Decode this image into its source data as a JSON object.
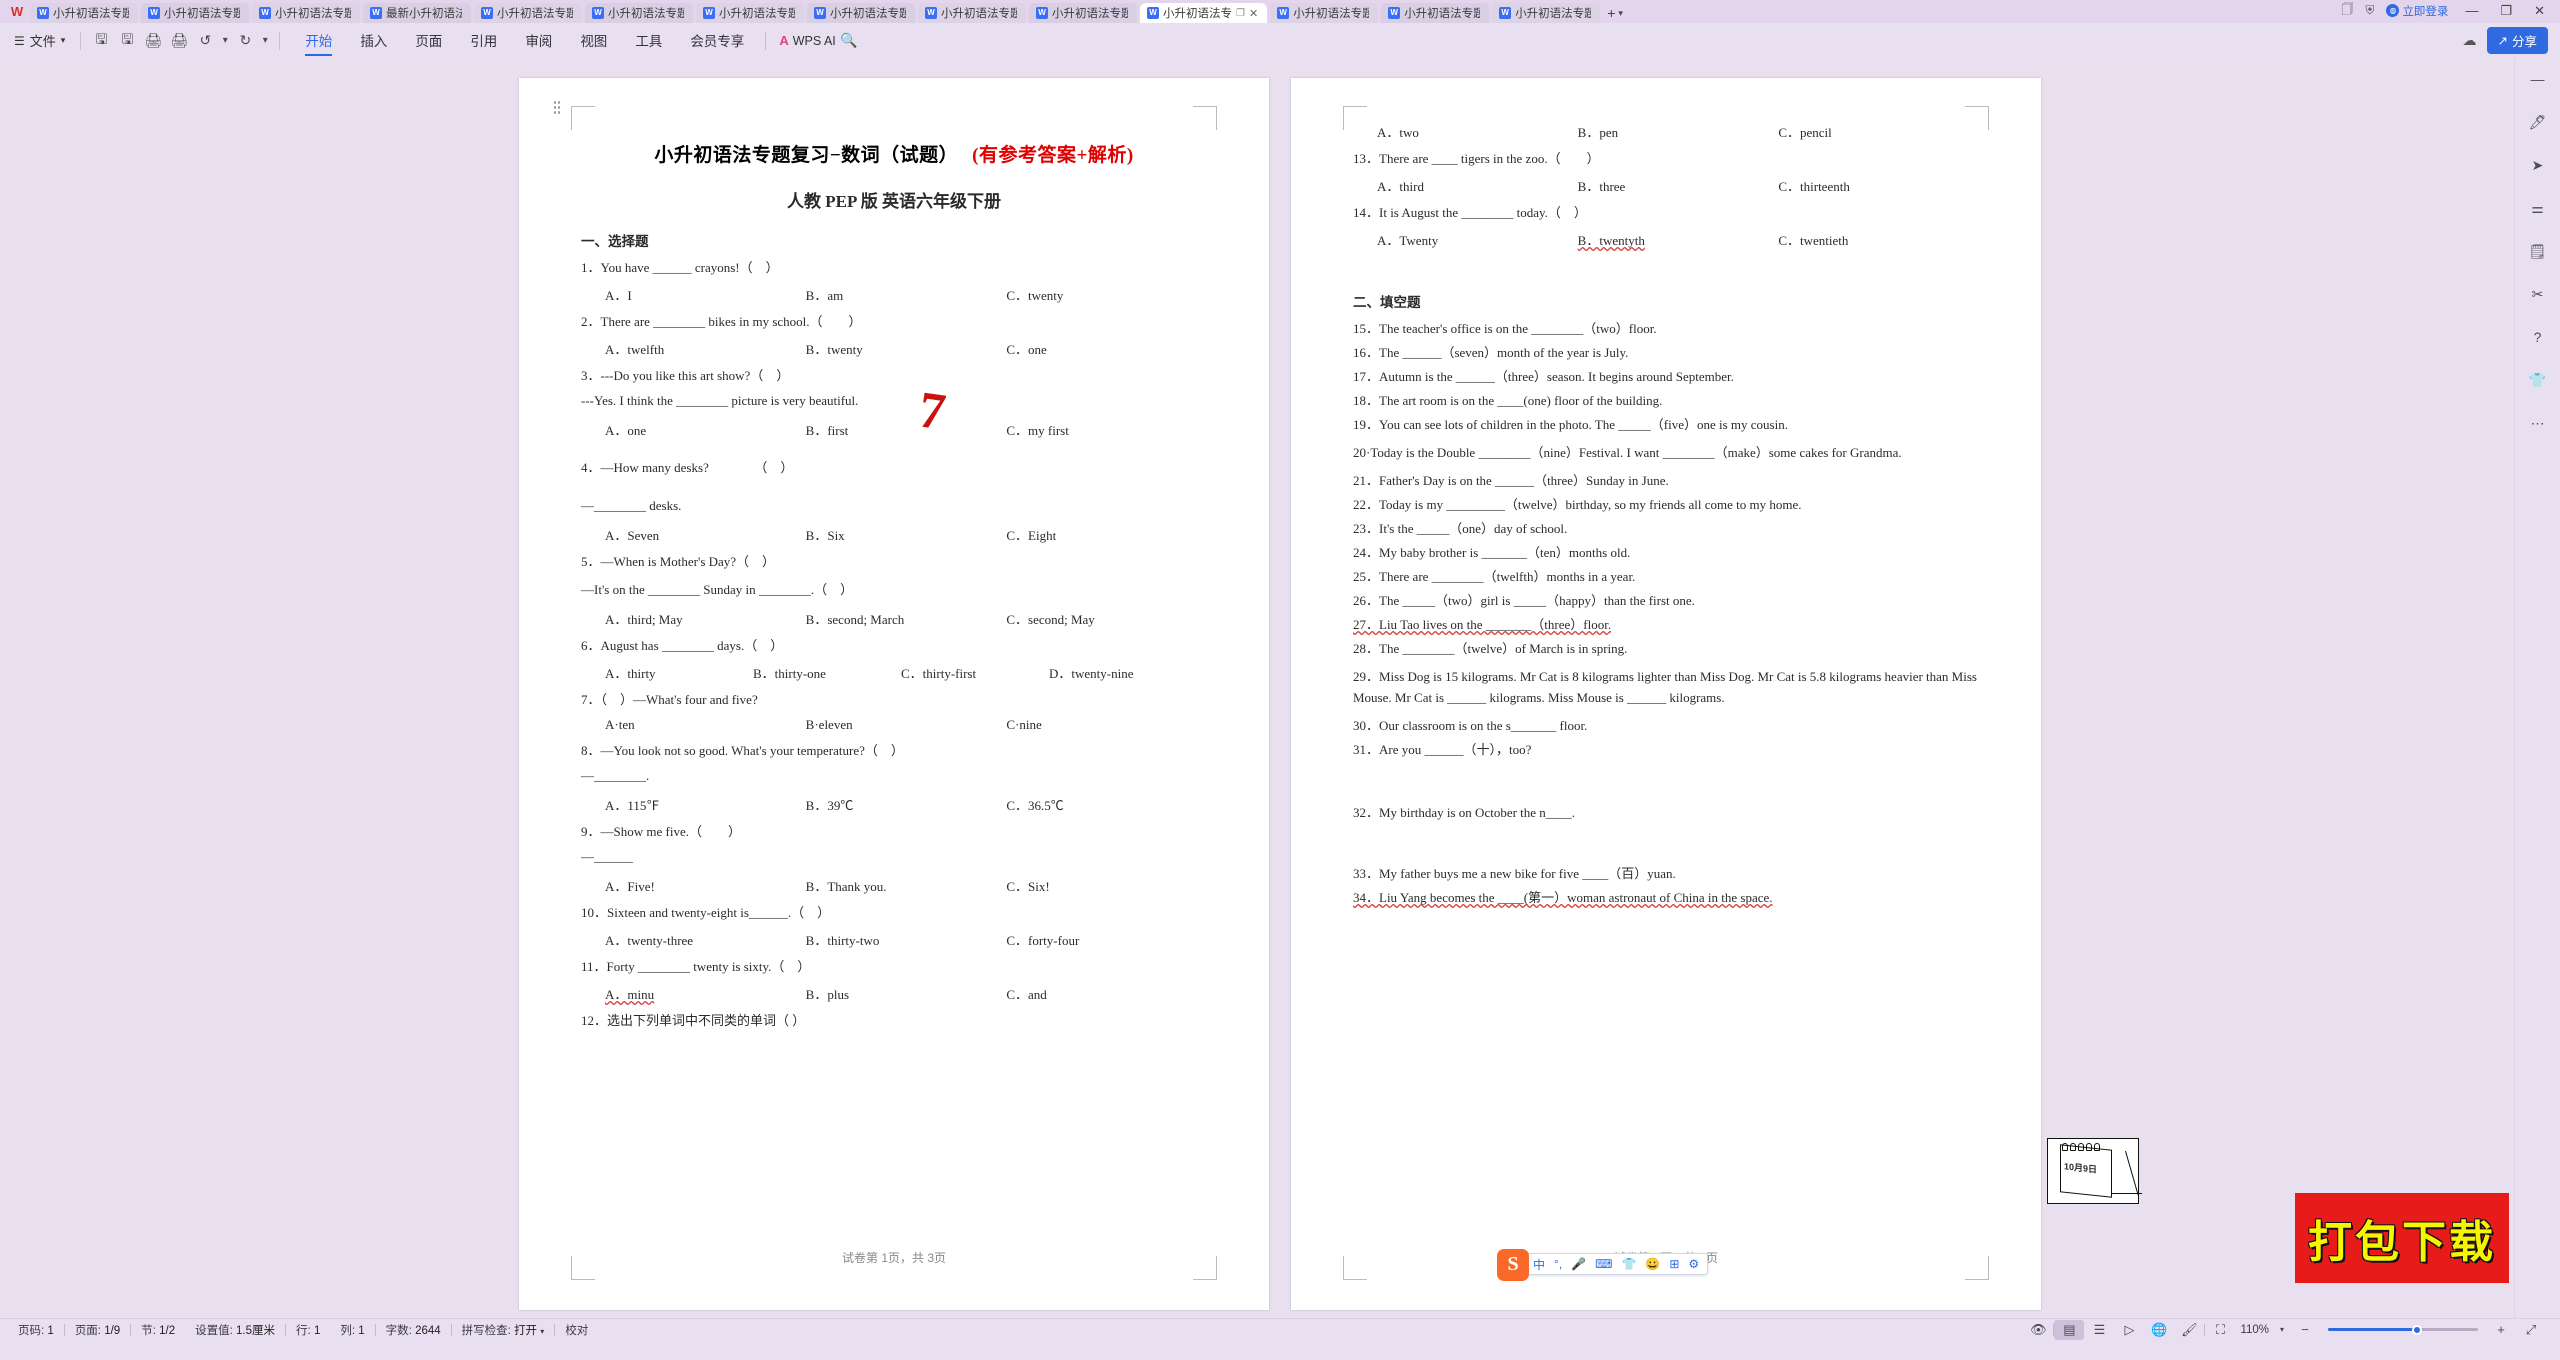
{
  "window": {
    "tabs": [
      {
        "label": "小升初语法专题复习",
        "active": false
      },
      {
        "label": "小升初语法专题复习",
        "active": false
      },
      {
        "label": "小升初语法专题复习",
        "active": false
      },
      {
        "label": "最新小升初语法专题",
        "active": false
      },
      {
        "label": "小升初语法专题复习",
        "active": false
      },
      {
        "label": "小升初语法专题复习",
        "active": false
      },
      {
        "label": "小升初语法专题复习",
        "active": false
      },
      {
        "label": "小升初语法专题复习",
        "active": false
      },
      {
        "label": "小升初语法专题复习",
        "active": false
      },
      {
        "label": "小升初语法专题复习",
        "active": false
      },
      {
        "label": "小升初语法专",
        "active": true
      },
      {
        "label": "小升初语法专题复习",
        "active": false
      },
      {
        "label": "小升初语法专题复习",
        "active": false
      },
      {
        "label": "小升初语法专题复习",
        "active": false
      }
    ],
    "new_tab_label": "+",
    "login_label": "立即登录",
    "minimize": "—",
    "restore": "❐",
    "close": "✕"
  },
  "ribbon": {
    "file_label": "文件",
    "quick_icons": [
      "save-icon",
      "save-as-icon",
      "print-icon",
      "print-preview-icon",
      "undo-icon",
      "redo-icon"
    ],
    "menus": [
      {
        "label": "开始",
        "active": true
      },
      {
        "label": "插入",
        "active": false
      },
      {
        "label": "页面",
        "active": false
      },
      {
        "label": "引用",
        "active": false
      },
      {
        "label": "审阅",
        "active": false
      },
      {
        "label": "视图",
        "active": false
      },
      {
        "label": "工具",
        "active": false
      },
      {
        "label": "会员专享",
        "active": false
      }
    ],
    "wps_ai": "WPS AI",
    "search": "search-icon",
    "share_label": "分享"
  },
  "document": {
    "title": "小升初语法专题复习−数词（试题）",
    "title_red": "(有参考答案+解析)",
    "subtitle": "人教 PEP 版 英语六年级下册",
    "section1": "一、选择题",
    "section2": "二、填空题",
    "pen_mark": "7",
    "calendar_text": "10月9日",
    "page1_footer": "试卷第 1页，共 3页",
    "page2_footer": "试卷第 2页，共 3页",
    "q1": "1．You have ______ crayons!（　）",
    "q1opts": [
      "A．I",
      "B．am",
      "C．twenty"
    ],
    "q2": "2．There are ________ bikes in my school.（　　）",
    "q2opts": [
      "A．twelfth",
      "B．twenty",
      "C．one"
    ],
    "q3": "3．---Do you like this art show?（　）",
    "q3b": "---Yes. I think the ________ picture is very beautiful.",
    "q3opts": [
      "A．one",
      "B．first",
      "C．my first"
    ],
    "q4": "4．—How many desks?　　　　（　）",
    "q4b": "—________ desks.",
    "q4opts": [
      "A．Seven",
      "B．Six",
      "C．Eight"
    ],
    "q5": "5．—When is Mother's Day?（　）",
    "q5b": "—It's on the ________ Sunday in ________.（　）",
    "q5opts": [
      "A．third; May",
      "B．second; March",
      "C．second; May"
    ],
    "q6": "6．August has ________ days.（　）",
    "q6opts": [
      "A．thirty",
      "B．thirty-one",
      "C．thirty-first",
      "D．twenty-nine"
    ],
    "q7": "7．（　）—What's four and five?",
    "q7opts": [
      "A·ten",
      "B·eleven",
      "C·nine"
    ],
    "q8": "8．—You look not so good. What's your temperature?（　）",
    "q8b": "—________.",
    "q8opts": [
      "A．115℉",
      "B．39℃",
      "C．36.5℃"
    ],
    "q9": "9．—Show me five.（　　）",
    "q9b": "—______",
    "q9opts": [
      "A．Five!",
      "B．Thank you.",
      "C．Six!"
    ],
    "q10": "10．Sixteen and twenty-eight is______.（　）",
    "q10opts": [
      "A．twenty-three",
      "B．thirty-two",
      "C．forty-four"
    ],
    "q11": "11．Forty ________ twenty is sixty.（　）",
    "q11opts": [
      "A．minu",
      "B．plus",
      "C．and"
    ],
    "q12": "12．选出下列单词中不同类的单词（ ）",
    "q12opts": [
      "A．two",
      "B．pen",
      "C．pencil"
    ],
    "q13": "13．There are ____ tigers in the zoo.（　　）",
    "q13opts": [
      "A．third",
      "B．three",
      "C．thirteenth"
    ],
    "q14": "14．It is August the ________ today.（　）",
    "q14opts": [
      "A．Twenty",
      "B．twentyth",
      "C．twentieth"
    ],
    "q15": "15．The teacher's office is on the ________（two）floor.",
    "q16": "16．The ______（seven）month of the year is July.",
    "q17": "17．Autumn is the ______（three）season. It begins around September.",
    "q18": "18．The art room is on the ____(one) floor of the building.",
    "q19": "19．You can see lots of children in the photo. The _____（five）one is my cousin.",
    "q20": "20·Today is the Double ________（nine）Festival. I want ________（make）some cakes for Grandma.",
    "q21": "21．Father's Day is on the ______（three）Sunday in June.",
    "q22": "22．Today is my _________（twelve）birthday, so my friends all come to my home.",
    "q23": "23．It's the _____（one）day of school.",
    "q24": "24．My baby brother is _______（ten）months old.",
    "q25": "25．There are ________（twelfth）months in a year.",
    "q26": "26．The _____（two）girl is _____（happy）than the first one.",
    "q27": "27．Liu Tao lives on the _______（three）floor.",
    "q28": "28．The ________（twelve）of March is in spring.",
    "q29": "29．Miss Dog is 15 kilograms. Mr Cat is 8 kilograms lighter than Miss Dog. Mr Cat is 5.8 kilograms heavier than Miss Mouse. Mr Cat is ______ kilograms. Miss Mouse is ______ kilograms.",
    "q30": "30．Our classroom is on the s_______ floor.",
    "q31": "31．Are you ______（十），too?",
    "q32": "32．My birthday is on October the n____.",
    "q33": "33．My father buys me a new bike for five ____（百）yuan.",
    "q34": "34．Liu Yang becomes the ____(第一）woman astronaut of China in the space."
  },
  "ime": {
    "logo": "S",
    "items": [
      "中",
      "°,",
      "mic-icon",
      "keyboard-icon",
      "skin-icon",
      "emoji-icon",
      "apps-icon",
      "settings-icon"
    ]
  },
  "watermark": {
    "text": "打包下载"
  },
  "right_toolbar": {
    "icons": [
      "collapse-icon",
      "pen-icon",
      "cursor-icon",
      "slider-icon",
      "scan-icon",
      "tools-icon",
      "help-icon",
      "skin-icon",
      "more-icon"
    ]
  },
  "status_bar": {
    "page_no_label": "页码:",
    "page_no": "1",
    "pages_label": "页面:",
    "pages": "1/9",
    "section_label": "节:",
    "section": "1/2",
    "setting_label": "设置值:",
    "setting": "1.5厘米",
    "row_label": "行:",
    "row": "1",
    "col_label": "列:",
    "col": "1",
    "words_label": "字数:",
    "words": "2644",
    "spell_label": "拼写检查:",
    "spell": "打开",
    "proof_label": "校对",
    "zoom": "110%",
    "view_icons": [
      "eye-icon",
      "page-view-icon",
      "outline-view-icon",
      "play-icon",
      "web-view-icon",
      "brush-icon",
      "fit-icon"
    ],
    "zoom_minus": "−",
    "zoom_plus": "+",
    "fullscreen": "⤢"
  }
}
